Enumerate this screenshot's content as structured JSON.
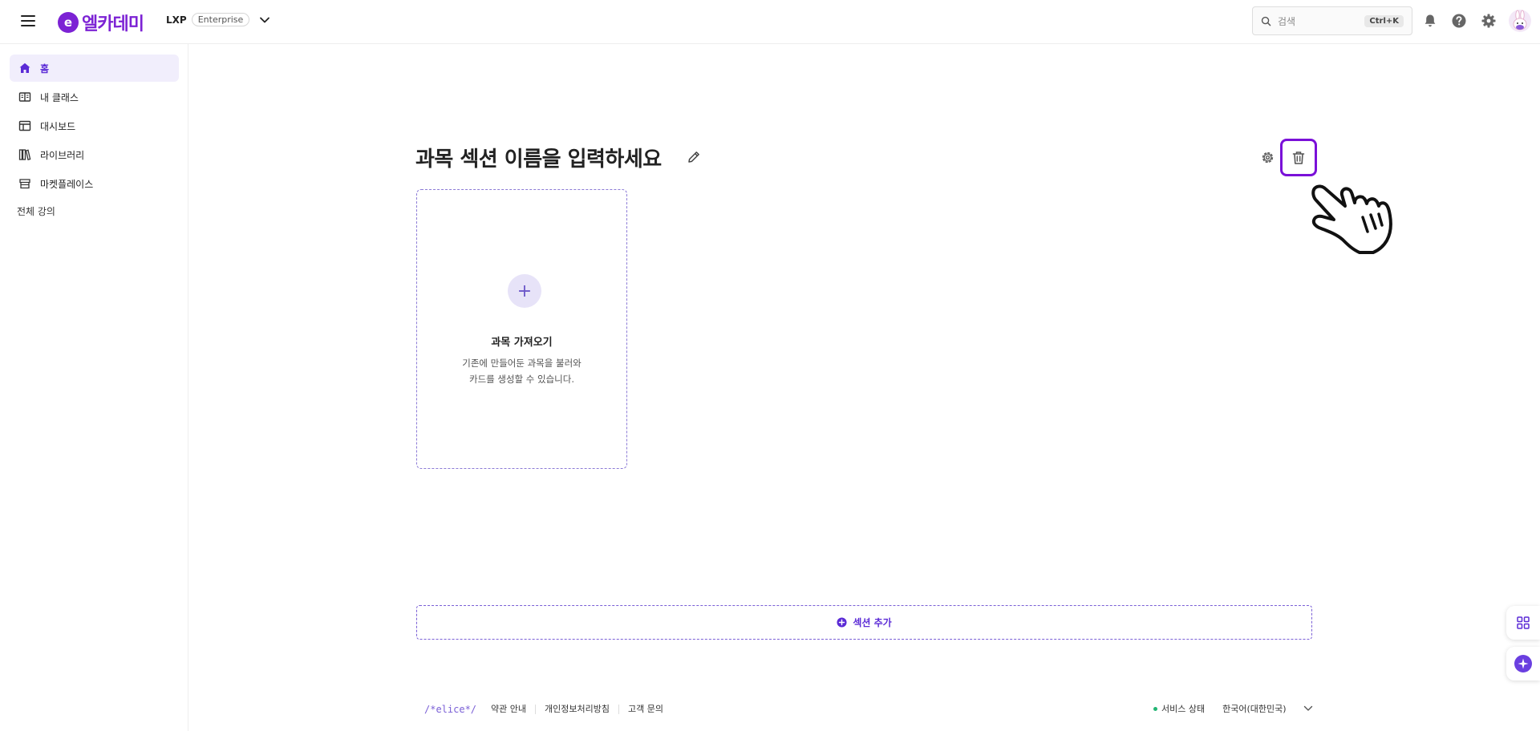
{
  "header": {
    "logo_mark": "e",
    "logo_text": "엘카데미",
    "org_name": "LXP",
    "org_plan": "Enterprise",
    "search_placeholder": "검색",
    "search_shortcut": "Ctrl+K",
    "icons": [
      "menu-icon",
      "chevron-down-icon",
      "search-icon",
      "bell-icon",
      "help-icon",
      "gear-icon",
      "avatar"
    ]
  },
  "sidebar": {
    "items": [
      {
        "label": "홈",
        "icon": "home-icon",
        "active": true
      },
      {
        "label": "내 클래스",
        "icon": "book-icon",
        "active": false
      },
      {
        "label": "대시보드",
        "icon": "dashboard-icon",
        "active": false
      },
      {
        "label": "라이브러리",
        "icon": "library-icon",
        "active": false
      },
      {
        "label": "마켓플레이스",
        "icon": "store-icon",
        "active": false
      }
    ],
    "all_courses": "전체 강의"
  },
  "main": {
    "section_title": "과목 섹션 이름을 입력하세요",
    "import_card": {
      "title": "과목 가져오기",
      "desc_line1": "기존에 만들어둔 과목을 불러와",
      "desc_line2": "카드를 생성할 수 있습니다."
    },
    "add_section_label": "섹션 추가"
  },
  "footer": {
    "brand": "/*elice*/",
    "links": [
      "약관 안내",
      "개인정보처리방침",
      "고객 문의"
    ],
    "service_status": "서비스 상태",
    "language": "한국어(대한민국)"
  },
  "colors": {
    "brand": "#7c22d4",
    "accent": "#5b2bd6",
    "highlight_border": "#7a10d8",
    "active_bg": "#f1eefc"
  }
}
